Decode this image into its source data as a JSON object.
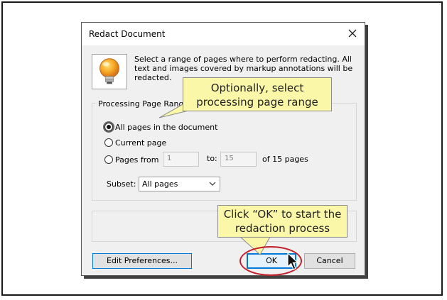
{
  "dialog": {
    "title": "Redact Document",
    "description": "Select a range of pages where to perform redacting. All text and images covered by markup annotations will be redacted.",
    "group_label": "Processing Page Range",
    "options": {
      "all_pages": "All pages in the document",
      "current_page": "Current page",
      "pages_from": "Pages from"
    },
    "from_value": "1",
    "to_label": "to:",
    "to_value": "15",
    "of_pages": "of 15 pages",
    "subset_label": "Subset:",
    "subset_value": "All pages",
    "buttons": {
      "edit_preferences": "Edit Preferences...",
      "ok": "OK",
      "cancel": "Cancel"
    }
  },
  "callouts": {
    "select_range_line1": "Optionally, select",
    "select_range_line2": "processing page range",
    "click_ok_line1": "Click “OK” to start the",
    "click_ok_line2": "redaction process"
  },
  "colors": {
    "callout_fill": "#fbf7a8",
    "highlight_ring": "#c0202a",
    "focus_blue": "#0078d7"
  },
  "icons": {
    "dialog_icon": "lightbulb-icon",
    "close": "close-icon",
    "dropdown": "chevron-down-icon",
    "pointer": "mouse-cursor-icon"
  }
}
